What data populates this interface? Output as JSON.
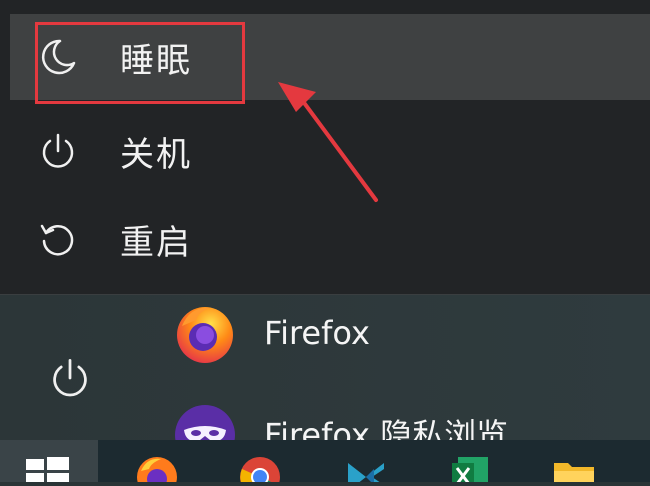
{
  "power_menu": {
    "items": [
      {
        "label": "睡眠",
        "icon": "moon-icon"
      },
      {
        "label": "关机",
        "icon": "power-icon"
      },
      {
        "label": "重启",
        "icon": "restart-icon"
      }
    ]
  },
  "start_menu": {
    "power_button_icon": "power-icon",
    "apps": [
      {
        "label": "Firefox",
        "icon": "firefox-icon"
      },
      {
        "label": "Firefox 隐私浏览",
        "icon": "firefox-private-icon"
      }
    ]
  },
  "taskbar": {
    "icons": [
      "windows-start-icon",
      "firefox-icon",
      "chrome-icon",
      "visual-studio-icon",
      "excel-icon",
      "file-explorer-icon"
    ]
  },
  "colors": {
    "highlight": "#e4393f",
    "menu_background": "#222426",
    "hover_background": "#3f4142"
  }
}
